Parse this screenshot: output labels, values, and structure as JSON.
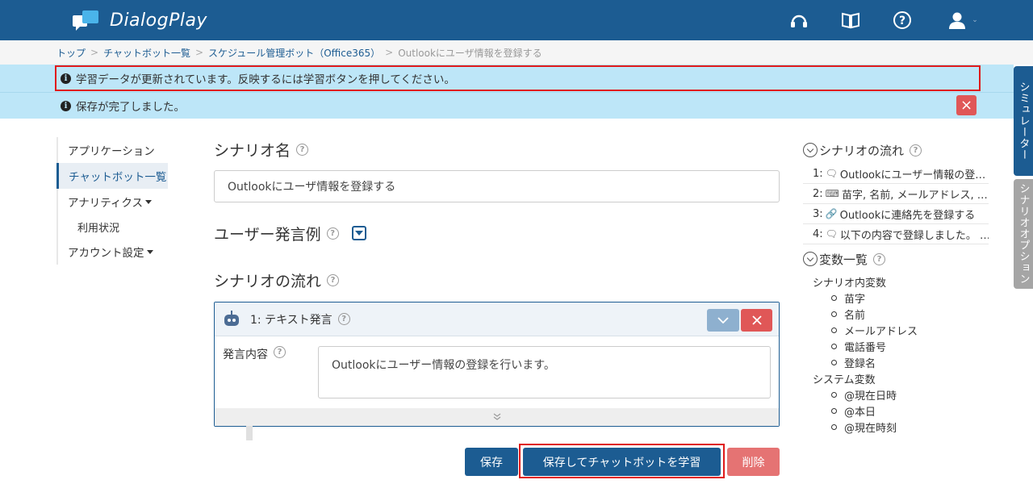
{
  "app": {
    "title": "DialogPlay"
  },
  "header_icons": [
    "headset-icon",
    "book-icon",
    "help-icon",
    "user-icon"
  ],
  "breadcrumb": [
    {
      "label": "トップ"
    },
    {
      "label": "チャットボット一覧"
    },
    {
      "label": "スケジュール管理ボット（Office365）"
    },
    {
      "label": "Outlookにユーザ情報を登録する"
    }
  ],
  "alerts": {
    "learn_notice": "学習データが更新されています。反映するには学習ボタンを押してください。",
    "save_notice": "保存が完了しました。",
    "close": "×"
  },
  "side_tabs": {
    "simulator": "シミュレーター",
    "scenario_options": "シナリオオプション"
  },
  "nav": {
    "application": "アプリケーション",
    "chatbot_list": "チャットボット一覧",
    "analytics": "アナリティクス",
    "usage": "利用状況",
    "account_settings": "アカウント設定"
  },
  "main": {
    "scenario_name_label": "シナリオ名",
    "scenario_name_value": "Outlookにユーザ情報を登録する",
    "utterance_examples_label": "ユーザー発言例",
    "flow_label": "シナリオの流れ"
  },
  "step_card": {
    "title": "1: テキスト発言",
    "content_label": "発言内容",
    "content_value": "Outlookにユーザー情報の登録を行います。"
  },
  "buttons": {
    "save": "保存",
    "save_and_learn": "保存してチャットボットを学習",
    "delete": "削除"
  },
  "right_panel": {
    "flow_title": "シナリオの流れ",
    "flow_items": [
      {
        "num": "1:",
        "icon": "speech-bubble-icon",
        "text": "Outlookにユーザー情報の登…"
      },
      {
        "num": "2:",
        "icon": "keyboard-icon",
        "text": "苗字, 名前, メールアドレス, …"
      },
      {
        "num": "3:",
        "icon": "link-icon",
        "text": "Outlookに連絡先を登録する"
      },
      {
        "num": "4:",
        "icon": "speech-bubble-icon",
        "text": "以下の内容で登録しました。 …"
      }
    ],
    "vars_title": "変数一覧",
    "scenario_vars_label": "シナリオ内変数",
    "scenario_vars": [
      "苗字",
      "名前",
      "メールアドレス",
      "電話番号",
      "登録名"
    ],
    "system_vars_label": "システム変数",
    "system_vars": [
      "@現在日時",
      "@本日",
      "@現在時刻"
    ]
  },
  "colors": {
    "brand": "#1c5c92",
    "alert_bg": "#bde6f8",
    "danger": "#e05757",
    "highlight": "#e01a1a"
  }
}
